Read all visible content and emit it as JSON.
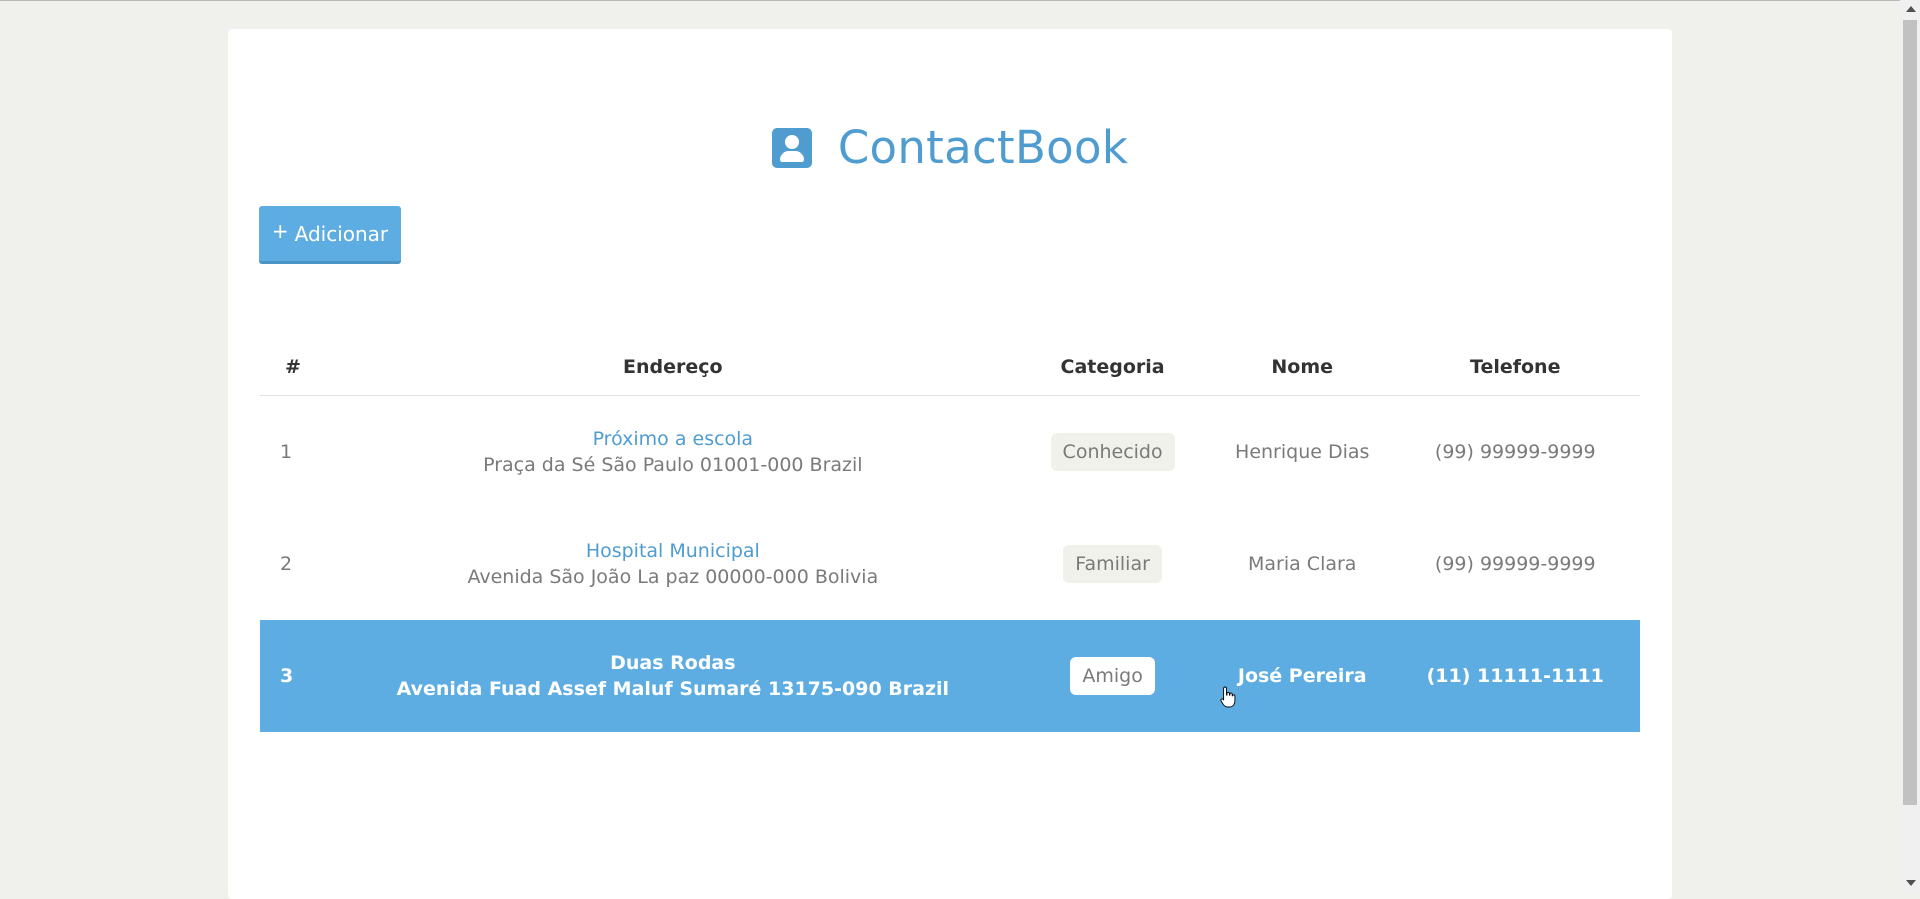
{
  "app": {
    "title": "ContactBook",
    "icon": "contact-book-icon",
    "accent_color": "#4f9cd0"
  },
  "toolbar": {
    "add_icon": "plus-icon",
    "add_label": "Adicionar",
    "button_color": "#5dade2"
  },
  "table": {
    "headers": {
      "num": "#",
      "address": "Endereço",
      "category": "Categoria",
      "name": "Nome",
      "phone": "Telefone"
    },
    "rows": [
      {
        "num": "1",
        "address_title": "Próximo a escola",
        "address_line": "Praça da Sé São Paulo 01001-000 Brazil",
        "category": "Conhecido",
        "name": "Henrique Dias",
        "phone": "(99) 99999-9999",
        "selected": false
      },
      {
        "num": "2",
        "address_title": "Hospital Municipal",
        "address_line": "Avenida São João La paz 00000-000 Bolivia",
        "category": "Familiar",
        "name": "Maria Clara",
        "phone": "(99) 99999-9999",
        "selected": false
      },
      {
        "num": "3",
        "address_title": "Duas Rodas",
        "address_line": "Avenida Fuad Assef Maluf Sumaré 13175-090 Brazil",
        "category": "Amigo",
        "name": "José Pereira",
        "phone": "(11) 11111-1111",
        "selected": true
      }
    ],
    "selected_row_color": "#5dade2"
  }
}
